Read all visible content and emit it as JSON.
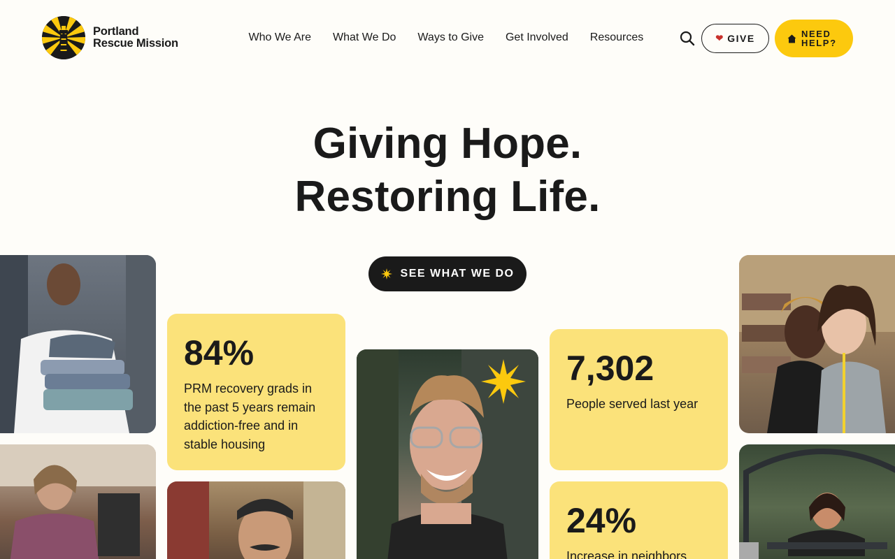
{
  "brand": {
    "name_line1": "Portland",
    "name_line2": "Rescue Mission",
    "accent": "#fcc90e",
    "dark": "#1a1a1a",
    "stat_bg": "#fbe27a"
  },
  "nav": {
    "items": [
      {
        "label": "Who We Are"
      },
      {
        "label": "What We Do"
      },
      {
        "label": "Ways to Give"
      },
      {
        "label": "Get Involved"
      },
      {
        "label": "Resources"
      }
    ],
    "search_icon": "search-icon",
    "give_label": "GIVE",
    "give_icon": "heart-icon",
    "help_label_line1": "NEED",
    "help_label_line2": "HELP?",
    "help_icon": "house-icon"
  },
  "hero": {
    "line1": "Giving Hope.",
    "line2": "Restoring Life.",
    "cta_label": "SEE WHAT WE DO",
    "cta_icon": "starburst-icon"
  },
  "stats": [
    {
      "value": "84%",
      "description": "PRM recovery grads in the past 5 years remain addiction-free and in stable housing"
    },
    {
      "value": "7,302",
      "description": "People served last year"
    },
    {
      "value": "24%",
      "description": "Increase in neighbors"
    }
  ]
}
